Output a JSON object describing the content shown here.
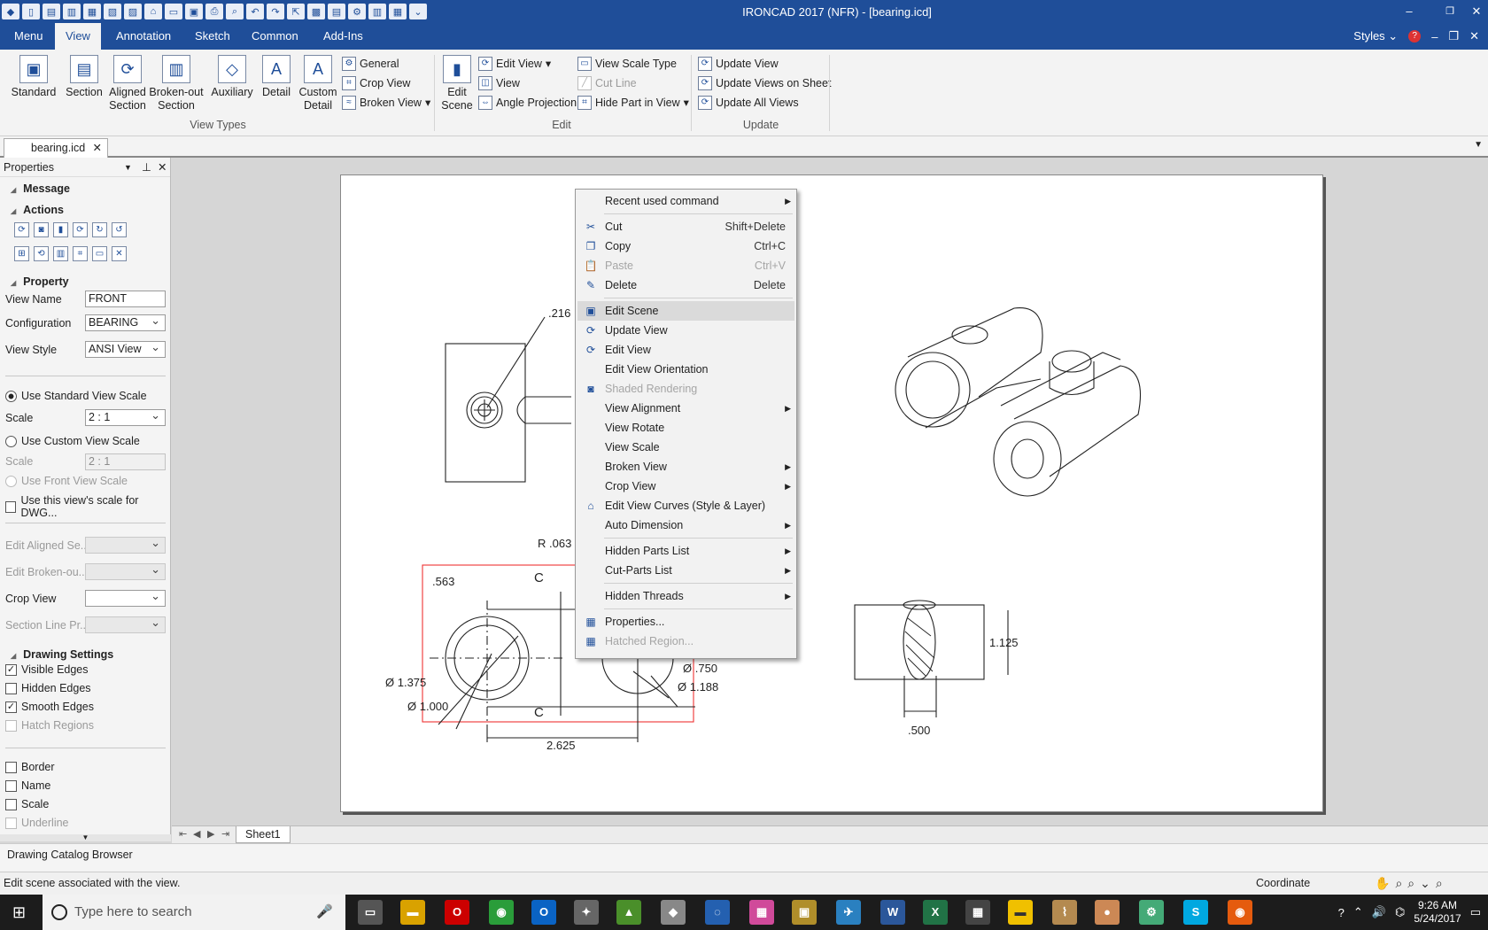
{
  "window": {
    "title": "IRONCAD 2017 (NFR) - [bearing.icd]",
    "min": "–",
    "restore": "❐",
    "close": "✕"
  },
  "tabs": [
    "Menu",
    "View",
    "Annotation",
    "Sketch",
    "Common",
    "Add-Ins"
  ],
  "tabs_right": {
    "styles": "Styles",
    "help": "?"
  },
  "ribbon": {
    "view_types": [
      "Standard",
      "Section",
      "Aligned Section",
      "Broken-out Section",
      "Auxiliary",
      "Detail",
      "Custom Detail"
    ],
    "view_types_small": [
      "General",
      "Crop View",
      "Broken View"
    ],
    "view_types_label": "View Types",
    "edit_big": "Edit Scene",
    "edit_small": [
      "Edit View",
      "View",
      "Angle Projection"
    ],
    "edit_small2": [
      "View Scale Type",
      "Cut Line",
      "Hide Part in View"
    ],
    "edit_label": "Edit",
    "update_small": [
      "Update View",
      "Update Views on Sheet",
      "Update All Views"
    ],
    "update_label": "Update"
  },
  "doc_tab": "bearing.icd",
  "properties": {
    "title": "Properties",
    "message": "Message",
    "actions": "Actions",
    "property": "Property",
    "view_name_label": "View Name",
    "view_name": "FRONT",
    "configuration_label": "Configuration",
    "configuration": "BEARING",
    "view_style_label": "View Style",
    "view_style": "ANSI View",
    "use_standard_scale": "Use Standard View Scale",
    "scale_label": "Scale",
    "scale": "2 : 1",
    "use_custom_scale": "Use Custom View Scale",
    "scale2_label": "Scale",
    "scale2": "2 : 1",
    "use_front_scale": "Use Front View Scale",
    "use_dwg_scale": "Use this view's scale for DWG...",
    "edit_aligned": "Edit Aligned Se...",
    "edit_broken": "Edit Broken-ou...",
    "crop_view": "Crop View",
    "section_line": "Section Line Pr...",
    "drawing_settings": "Drawing Settings",
    "visible_edges": "Visible Edges",
    "hidden_edges": "Hidden Edges",
    "smooth_edges": "Smooth Edges",
    "hatch_regions": "Hatch Regions",
    "border": "Border",
    "name": "Name",
    "scale_chk": "Scale",
    "underline": "Underline"
  },
  "drawing": {
    "dims": [
      ".216",
      "R .063",
      ".563",
      "Ø 1.375",
      "Ø 1.000",
      "2.625",
      "Ø .750",
      "Ø 1.188",
      "1.125",
      ".500",
      "C",
      "C"
    ]
  },
  "sheet_tab": "Sheet1",
  "context_menu": [
    {
      "label": "Recent used command",
      "submenu": true
    },
    {
      "sep": true
    },
    {
      "label": "Cut",
      "shortcut": "Shift+Delete",
      "icon": "✂"
    },
    {
      "label": "Copy",
      "shortcut": "Ctrl+C",
      "icon": "❐"
    },
    {
      "label": "Paste",
      "shortcut": "Ctrl+V",
      "disabled": true,
      "icon": "📋"
    },
    {
      "label": "Delete",
      "shortcut": "Delete",
      "icon": "✎"
    },
    {
      "sep": true
    },
    {
      "label": "Edit Scene",
      "highlight": true,
      "icon": "▣"
    },
    {
      "label": "Update View",
      "icon": "⟳"
    },
    {
      "label": "Edit View",
      "icon": "⟳"
    },
    {
      "label": "Edit View Orientation"
    },
    {
      "label": "Shaded Rendering",
      "disabled": true,
      "icon": "◙"
    },
    {
      "label": "View Alignment",
      "submenu": true
    },
    {
      "label": "View Rotate"
    },
    {
      "label": "View Scale"
    },
    {
      "label": "Broken View",
      "submenu": true
    },
    {
      "label": "Crop View",
      "submenu": true
    },
    {
      "label": "Edit View Curves (Style & Layer)",
      "icon": "⌂"
    },
    {
      "label": "Auto Dimension",
      "submenu": true
    },
    {
      "sep": true
    },
    {
      "label": "Hidden Parts List",
      "submenu": true
    },
    {
      "label": "Cut-Parts List",
      "submenu": true
    },
    {
      "sep": true
    },
    {
      "label": "Hidden Threads",
      "submenu": true
    },
    {
      "sep": true
    },
    {
      "label": "Properties...",
      "icon": "▦"
    },
    {
      "label": "Hatched Region...",
      "disabled": true,
      "icon": "▦"
    }
  ],
  "catalog_browser": "Drawing Catalog Browser",
  "status": {
    "message": "Edit scene associated with the view.",
    "coordinate": "Coordinate"
  },
  "taskbar": {
    "search": "Type here to search",
    "time": "9:26 AM",
    "date": "5/24/2017"
  }
}
